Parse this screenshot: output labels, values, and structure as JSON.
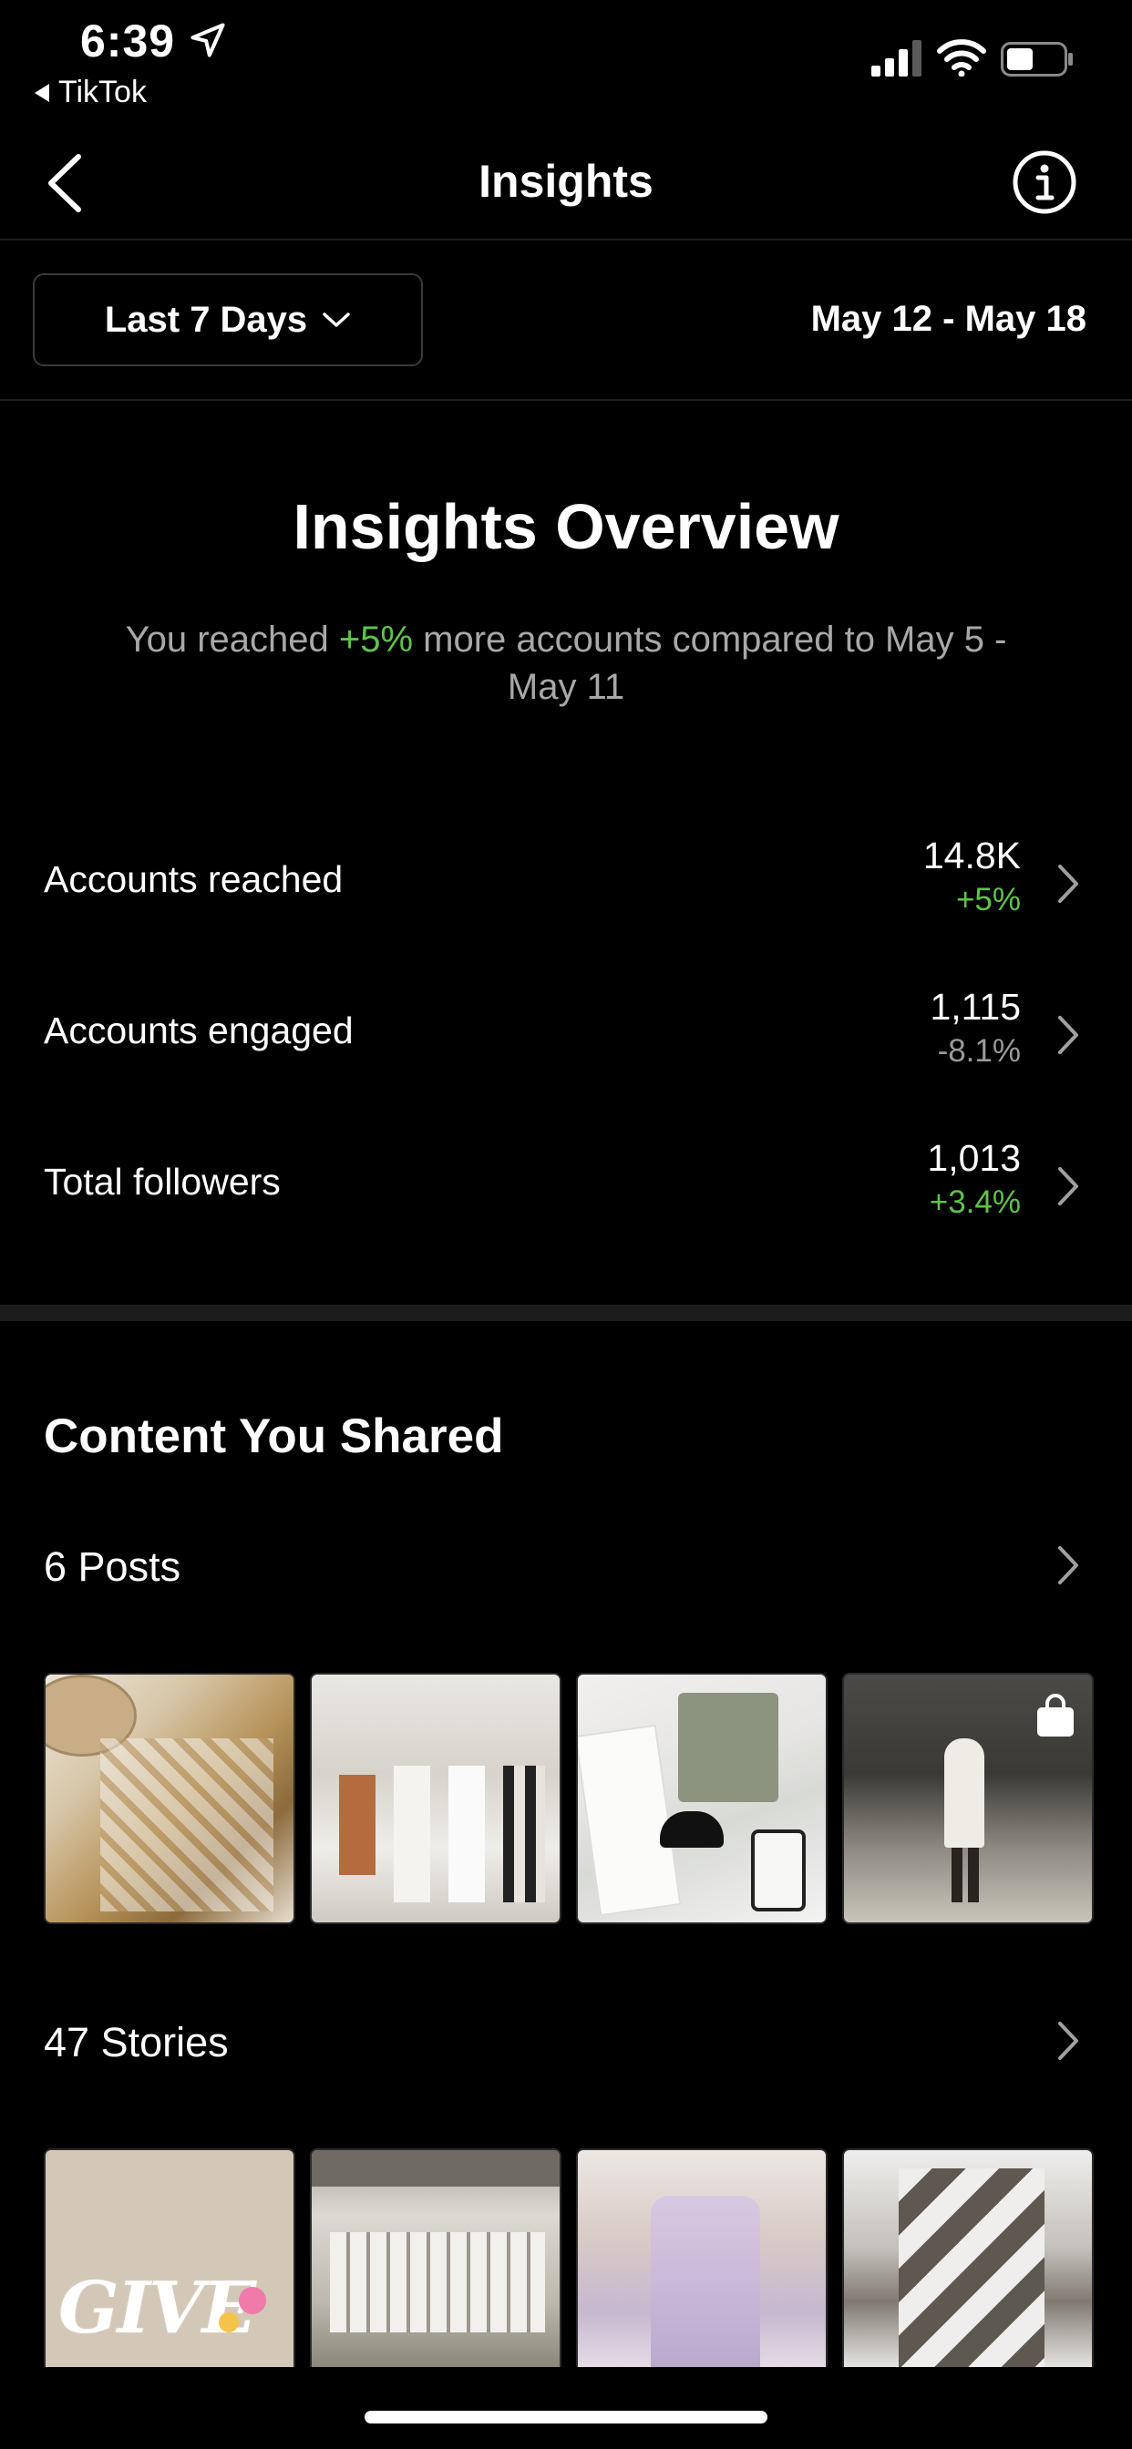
{
  "status_bar": {
    "time": "6:39",
    "back_app": "TikTok",
    "icons": [
      "location-arrow-icon",
      "cellular-signal-icon",
      "wifi-icon",
      "battery-icon"
    ]
  },
  "nav": {
    "title": "Insights",
    "back_icon": "chevron-left-icon",
    "info_icon": "info-circle-icon"
  },
  "filter": {
    "range_label": "Last 7 Days",
    "date_range": "May 12 - May 18"
  },
  "overview": {
    "title": "Insights Overview",
    "subtitle_prefix": "You reached ",
    "subtitle_highlight": "+5%",
    "subtitle_suffix": " more accounts compared to May 5 - May 11",
    "metrics": [
      {
        "label": "Accounts reached",
        "value": "14.8K",
        "change": "+5%"
      },
      {
        "label": "Accounts engaged",
        "value": "1,115",
        "change": "-8.1%"
      },
      {
        "label": "Total followers",
        "value": "1,013",
        "change": "+3.4%"
      }
    ]
  },
  "content": {
    "title": "Content You Shared",
    "posts_label": "6 Posts",
    "stories_label": "47 Stories",
    "posts": [
      {
        "subject": "floral dress with straw hat"
      },
      {
        "subject": "clothing rack on mannequins"
      },
      {
        "subject": "white jeans and knit top flatlay"
      },
      {
        "subject": "woman in white outfit in driveway"
      }
    ],
    "stories": [
      {
        "subject": "give away graphic",
        "text": "GIVE"
      },
      {
        "subject": "building facade"
      },
      {
        "subject": "floral slip dress"
      },
      {
        "subject": "checkered pants"
      }
    ]
  },
  "colors": {
    "background": "#000000",
    "positive": "#5ec44a",
    "muted": "#a8a8a8"
  }
}
